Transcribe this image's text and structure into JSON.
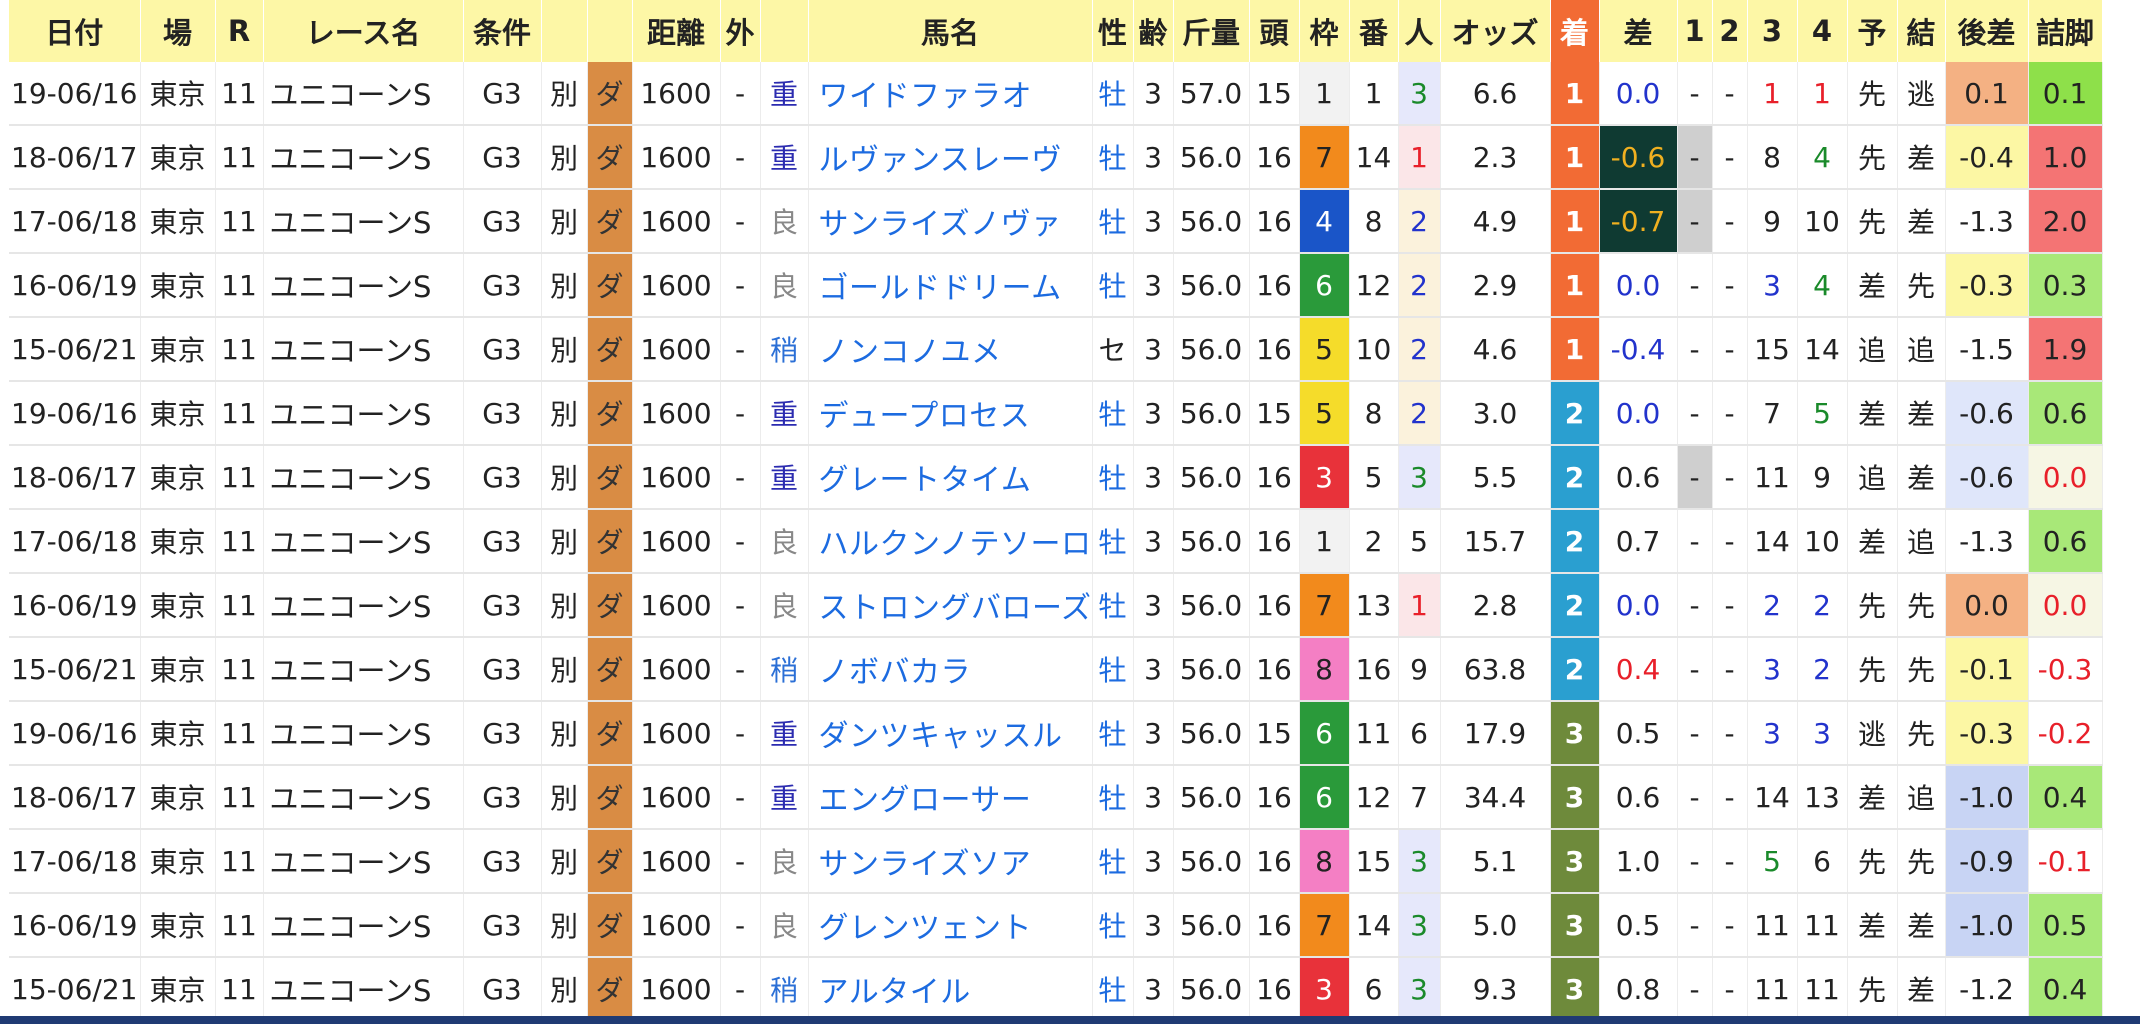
{
  "headers": [
    "日付",
    "場",
    "R",
    "レース名",
    "条件",
    "",
    "",
    "距離",
    "外",
    "",
    "馬名",
    "性",
    "齢",
    "斤量",
    "頭",
    "枠",
    "番",
    "人",
    "オッズ",
    "着",
    "差",
    "1",
    "2",
    "3",
    "4",
    "予",
    "結",
    "後差",
    "詰脚"
  ],
  "rows": [
    {
      "date": "19-06/16",
      "venue": "東京",
      "race": "11",
      "race_name": "ユニコーンS",
      "grade": "G3",
      "cond": "別",
      "surface": "ダ",
      "distance": "1600",
      "outside": "-",
      "track": "重",
      "horse": "ワイドファラオ",
      "sex": "牡",
      "age": "3",
      "weight": "57.0",
      "heads": "15",
      "frame": "1",
      "num": "1",
      "pop": "3",
      "odds": "6.6",
      "finish": "1",
      "diff": "0.0",
      "c1": "-",
      "c2": "-",
      "c3": "1",
      "c4": "1",
      "pred": "先",
      "result": "逃",
      "late_diff": "0.1",
      "close": "0.1"
    },
    {
      "date": "18-06/17",
      "venue": "東京",
      "race": "11",
      "race_name": "ユニコーンS",
      "grade": "G3",
      "cond": "別",
      "surface": "ダ",
      "distance": "1600",
      "outside": "-",
      "track": "重",
      "horse": "ルヴァンスレーヴ",
      "sex": "牡",
      "age": "3",
      "weight": "56.0",
      "heads": "16",
      "frame": "7",
      "num": "14",
      "pop": "1",
      "odds": "2.3",
      "finish": "1",
      "diff": "-0.6",
      "c1": "-",
      "c2": "-",
      "c3": "8",
      "c4": "4",
      "pred": "先",
      "result": "差",
      "late_diff": "-0.4",
      "close": "1.0"
    },
    {
      "date": "17-06/18",
      "venue": "東京",
      "race": "11",
      "race_name": "ユニコーンS",
      "grade": "G3",
      "cond": "別",
      "surface": "ダ",
      "distance": "1600",
      "outside": "-",
      "track": "良",
      "horse": "サンライズノヴァ",
      "sex": "牡",
      "age": "3",
      "weight": "56.0",
      "heads": "16",
      "frame": "4",
      "num": "8",
      "pop": "2",
      "odds": "4.9",
      "finish": "1",
      "diff": "-0.7",
      "c1": "-",
      "c2": "-",
      "c3": "9",
      "c4": "10",
      "pred": "先",
      "result": "差",
      "late_diff": "-1.3",
      "close": "2.0"
    },
    {
      "date": "16-06/19",
      "venue": "東京",
      "race": "11",
      "race_name": "ユニコーンS",
      "grade": "G3",
      "cond": "別",
      "surface": "ダ",
      "distance": "1600",
      "outside": "-",
      "track": "良",
      "horse": "ゴールドドリーム",
      "sex": "牡",
      "age": "3",
      "weight": "56.0",
      "heads": "16",
      "frame": "6",
      "num": "12",
      "pop": "2",
      "odds": "2.9",
      "finish": "1",
      "diff": "0.0",
      "c1": "-",
      "c2": "-",
      "c3": "3",
      "c4": "4",
      "pred": "差",
      "result": "先",
      "late_diff": "-0.3",
      "close": "0.3"
    },
    {
      "date": "15-06/21",
      "venue": "東京",
      "race": "11",
      "race_name": "ユニコーンS",
      "grade": "G3",
      "cond": "別",
      "surface": "ダ",
      "distance": "1600",
      "outside": "-",
      "track": "稍",
      "horse": "ノンコノユメ",
      "sex": "セ",
      "age": "3",
      "weight": "56.0",
      "heads": "16",
      "frame": "5",
      "num": "10",
      "pop": "2",
      "odds": "4.6",
      "finish": "1",
      "diff": "-0.4",
      "c1": "-",
      "c2": "-",
      "c3": "15",
      "c4": "14",
      "pred": "追",
      "result": "追",
      "late_diff": "-1.5",
      "close": "1.9"
    },
    {
      "date": "19-06/16",
      "venue": "東京",
      "race": "11",
      "race_name": "ユニコーンS",
      "grade": "G3",
      "cond": "別",
      "surface": "ダ",
      "distance": "1600",
      "outside": "-",
      "track": "重",
      "horse": "デュープロセス",
      "sex": "牡",
      "age": "3",
      "weight": "56.0",
      "heads": "15",
      "frame": "5",
      "num": "8",
      "pop": "2",
      "odds": "3.0",
      "finish": "2",
      "diff": "0.0",
      "c1": "-",
      "c2": "-",
      "c3": "7",
      "c4": "5",
      "pred": "差",
      "result": "差",
      "late_diff": "-0.6",
      "close": "0.6"
    },
    {
      "date": "18-06/17",
      "venue": "東京",
      "race": "11",
      "race_name": "ユニコーンS",
      "grade": "G3",
      "cond": "別",
      "surface": "ダ",
      "distance": "1600",
      "outside": "-",
      "track": "重",
      "horse": "グレートタイム",
      "sex": "牡",
      "age": "3",
      "weight": "56.0",
      "heads": "16",
      "frame": "3",
      "num": "5",
      "pop": "3",
      "odds": "5.5",
      "finish": "2",
      "diff": "0.6",
      "c1": "-",
      "c2": "-",
      "c3": "11",
      "c4": "9",
      "pred": "追",
      "result": "差",
      "late_diff": "-0.6",
      "close": "0.0"
    },
    {
      "date": "17-06/18",
      "venue": "東京",
      "race": "11",
      "race_name": "ユニコーンS",
      "grade": "G3",
      "cond": "別",
      "surface": "ダ",
      "distance": "1600",
      "outside": "-",
      "track": "良",
      "horse": "ハルクンノテソーロ",
      "sex": "牡",
      "age": "3",
      "weight": "56.0",
      "heads": "16",
      "frame": "1",
      "num": "2",
      "pop": "5",
      "odds": "15.7",
      "finish": "2",
      "diff": "0.7",
      "c1": "-",
      "c2": "-",
      "c3": "14",
      "c4": "10",
      "pred": "差",
      "result": "追",
      "late_diff": "-1.3",
      "close": "0.6"
    },
    {
      "date": "16-06/19",
      "venue": "東京",
      "race": "11",
      "race_name": "ユニコーンS",
      "grade": "G3",
      "cond": "別",
      "surface": "ダ",
      "distance": "1600",
      "outside": "-",
      "track": "良",
      "horse": "ストロングバローズ",
      "sex": "牡",
      "age": "3",
      "weight": "56.0",
      "heads": "16",
      "frame": "7",
      "num": "13",
      "pop": "1",
      "odds": "2.8",
      "finish": "2",
      "diff": "0.0",
      "c1": "-",
      "c2": "-",
      "c3": "2",
      "c4": "2",
      "pred": "先",
      "result": "先",
      "late_diff": "0.0",
      "close": "0.0"
    },
    {
      "date": "15-06/21",
      "venue": "東京",
      "race": "11",
      "race_name": "ユニコーンS",
      "grade": "G3",
      "cond": "別",
      "surface": "ダ",
      "distance": "1600",
      "outside": "-",
      "track": "稍",
      "horse": "ノボバカラ",
      "sex": "牡",
      "age": "3",
      "weight": "56.0",
      "heads": "16",
      "frame": "8",
      "num": "16",
      "pop": "9",
      "odds": "63.8",
      "finish": "2",
      "diff": "0.4",
      "c1": "-",
      "c2": "-",
      "c3": "3",
      "c4": "2",
      "pred": "先",
      "result": "先",
      "late_diff": "-0.1",
      "close": "-0.3"
    },
    {
      "date": "19-06/16",
      "venue": "東京",
      "race": "11",
      "race_name": "ユニコーンS",
      "grade": "G3",
      "cond": "別",
      "surface": "ダ",
      "distance": "1600",
      "outside": "-",
      "track": "重",
      "horse": "ダンツキャッスル",
      "sex": "牡",
      "age": "3",
      "weight": "56.0",
      "heads": "15",
      "frame": "6",
      "num": "11",
      "pop": "6",
      "odds": "17.9",
      "finish": "3",
      "diff": "0.5",
      "c1": "-",
      "c2": "-",
      "c3": "3",
      "c4": "3",
      "pred": "逃",
      "result": "先",
      "late_diff": "-0.3",
      "close": "-0.2"
    },
    {
      "date": "18-06/17",
      "venue": "東京",
      "race": "11",
      "race_name": "ユニコーンS",
      "grade": "G3",
      "cond": "別",
      "surface": "ダ",
      "distance": "1600",
      "outside": "-",
      "track": "重",
      "horse": "エングローサー",
      "sex": "牡",
      "age": "3",
      "weight": "56.0",
      "heads": "16",
      "frame": "6",
      "num": "12",
      "pop": "7",
      "odds": "34.4",
      "finish": "3",
      "diff": "0.6",
      "c1": "-",
      "c2": "-",
      "c3": "14",
      "c4": "13",
      "pred": "差",
      "result": "追",
      "late_diff": "-1.0",
      "close": "0.4"
    },
    {
      "date": "17-06/18",
      "venue": "東京",
      "race": "11",
      "race_name": "ユニコーンS",
      "grade": "G3",
      "cond": "別",
      "surface": "ダ",
      "distance": "1600",
      "outside": "-",
      "track": "良",
      "horse": "サンライズソア",
      "sex": "牡",
      "age": "3",
      "weight": "56.0",
      "heads": "16",
      "frame": "8",
      "num": "15",
      "pop": "3",
      "odds": "5.1",
      "finish": "3",
      "diff": "1.0",
      "c1": "-",
      "c2": "-",
      "c3": "5",
      "c4": "6",
      "pred": "先",
      "result": "先",
      "late_diff": "-0.9",
      "close": "-0.1"
    },
    {
      "date": "16-06/19",
      "venue": "東京",
      "race": "11",
      "race_name": "ユニコーンS",
      "grade": "G3",
      "cond": "別",
      "surface": "ダ",
      "distance": "1600",
      "outside": "-",
      "track": "良",
      "horse": "グレンツェント",
      "sex": "牡",
      "age": "3",
      "weight": "56.0",
      "heads": "16",
      "frame": "7",
      "num": "14",
      "pop": "3",
      "odds": "5.0",
      "finish": "3",
      "diff": "0.5",
      "c1": "-",
      "c2": "-",
      "c3": "11",
      "c4": "11",
      "pred": "差",
      "result": "差",
      "late_diff": "-1.0",
      "close": "0.5"
    },
    {
      "date": "15-06/21",
      "venue": "東京",
      "race": "11",
      "race_name": "ユニコーンS",
      "grade": "G3",
      "cond": "別",
      "surface": "ダ",
      "distance": "1600",
      "outside": "-",
      "track": "稍",
      "horse": "アルタイル",
      "sex": "牡",
      "age": "3",
      "weight": "56.0",
      "heads": "16",
      "frame": "3",
      "num": "6",
      "pop": "3",
      "odds": "9.3",
      "finish": "3",
      "diff": "0.8",
      "c1": "-",
      "c2": "-",
      "c3": "11",
      "c4": "11",
      "pred": "先",
      "result": "差",
      "late_diff": "-1.2",
      "close": "0.4"
    }
  ],
  "colors": {
    "header_bg": "#fdf7a6",
    "finish_header": "#f26b34",
    "finish_1": "#f26b34",
    "finish_2": "#2a9fd0",
    "finish_3": "#6e8a3b",
    "frame_1": "#f2f2f2",
    "frame_3": "#e8323a",
    "frame_4": "#1a55c8",
    "frame_5": "#f5dc2a",
    "frame_6": "#2a9a3a",
    "frame_7": "#f28a1c",
    "frame_8": "#f47fc4",
    "dirt": "#d98c44"
  }
}
